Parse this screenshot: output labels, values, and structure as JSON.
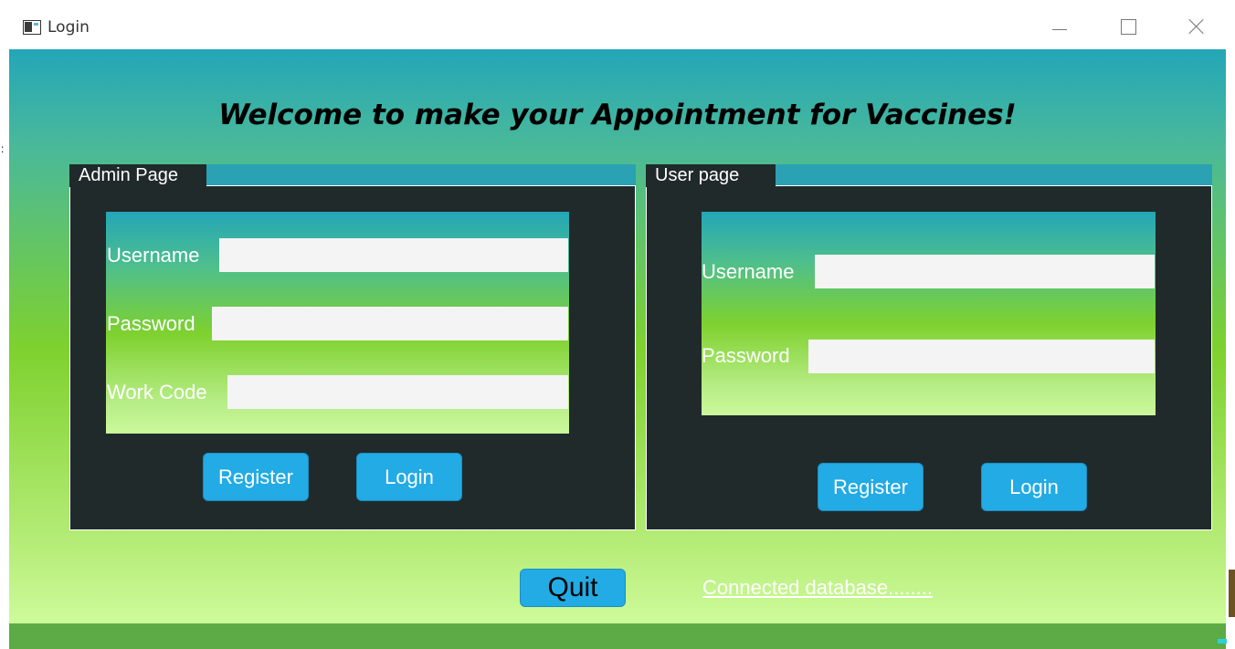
{
  "window": {
    "title": "Login"
  },
  "heading": "Welcome to make your Appointment for Vaccines!",
  "admin": {
    "group_title": "Admin Page",
    "username_label": "Username",
    "password_label": "Password",
    "workcode_label": "Work Code",
    "username_value": "",
    "password_value": "",
    "workcode_value": "",
    "register_label": "Register",
    "login_label": "Login"
  },
  "user": {
    "group_title": "User  page",
    "username_label": "Username",
    "password_label": "Password",
    "username_value": "",
    "password_value": "",
    "register_label": "Register",
    "login_label": "Login"
  },
  "footer": {
    "quit_label": "Quit",
    "status_text": "Connected database........"
  },
  "colors": {
    "group_background": "#212a2b",
    "button": "#22abe4",
    "gradient_top": "#23a6b8",
    "gradient_mid": "#7ed12e",
    "gradient_bottom": "#ccfa98"
  }
}
